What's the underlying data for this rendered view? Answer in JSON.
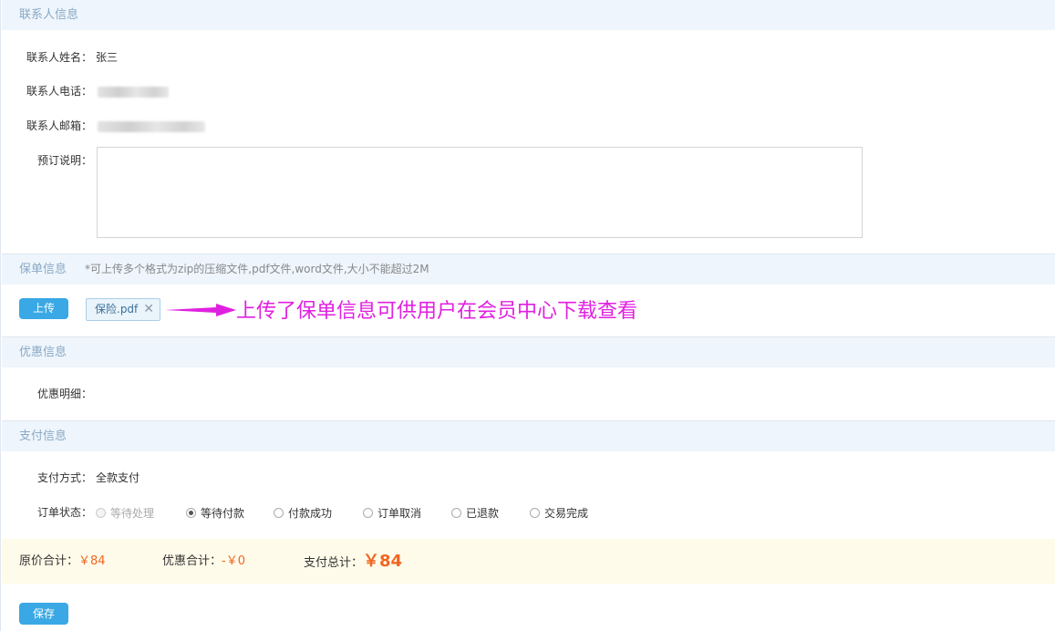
{
  "contact": {
    "title": "联系人信息",
    "name_label": "联系人姓名：",
    "name_value": "张三",
    "phone_label": "联系人电话：",
    "email_label": "联系人邮箱：",
    "remark_label": "预订说明："
  },
  "policy": {
    "title": "保单信息",
    "note": "*可上传多个格式为zip的压缩文件,pdf文件,word文件,大小不能超过2M",
    "upload_label": "上传",
    "file_name": "保险.pdf",
    "annotation": "上传了保单信息可供用户在会员中心下载查看",
    "annotation_color": "#e020e0"
  },
  "discount": {
    "title": "优惠信息",
    "detail_label": "优惠明细："
  },
  "payment": {
    "title": "支付信息",
    "method_label": "支付方式：",
    "method_value": "全款支付",
    "status_label": "订单状态：",
    "statuses": [
      {
        "label": "等待处理",
        "state": "disabled"
      },
      {
        "label": "等待付款",
        "state": "checked"
      },
      {
        "label": "付款成功",
        "state": "unchecked"
      },
      {
        "label": "订单取消",
        "state": "unchecked"
      },
      {
        "label": "已退款",
        "state": "unchecked"
      },
      {
        "label": "交易完成",
        "state": "unchecked"
      }
    ]
  },
  "totals": {
    "original_label": "原价合计：",
    "original_value": "￥84",
    "discount_label": "优惠合计：",
    "discount_value": "-￥0",
    "pay_label": "支付总计：",
    "pay_value": "￥84"
  },
  "save_label": "保存",
  "colors": {
    "accent": "#3aa8e4",
    "price": "#f26522",
    "section_bg": "#eef5fc",
    "totals_bg": "#fffbea"
  }
}
